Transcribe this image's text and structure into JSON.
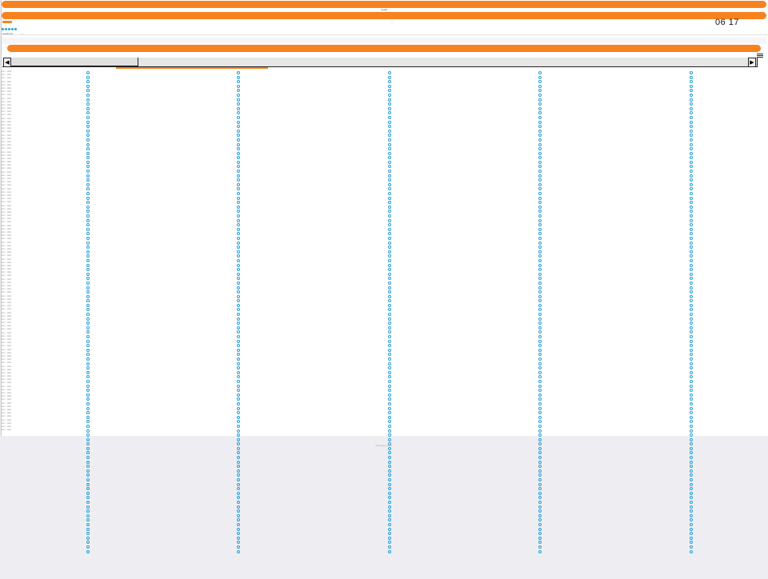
{
  "header": {
    "title": "Leads",
    "subtitle": "--",
    "clock": "06 17"
  },
  "tabs": [
    {
      "label": "Leads list"
    },
    {
      "label": "—"
    },
    {
      "label": "···"
    }
  ],
  "menu_icon": "hamburger-icon",
  "scroll_icons": [
    "left-arrow-icon",
    "right-arrow-icon"
  ],
  "grid": {
    "row_label": "item · label",
    "row_count": 108,
    "column_count": 5
  },
  "footer": {
    "text": "Showing results"
  },
  "colors": {
    "accent": "#f6831f",
    "dot": "#2a9fd6",
    "background": "#eeeef2"
  }
}
